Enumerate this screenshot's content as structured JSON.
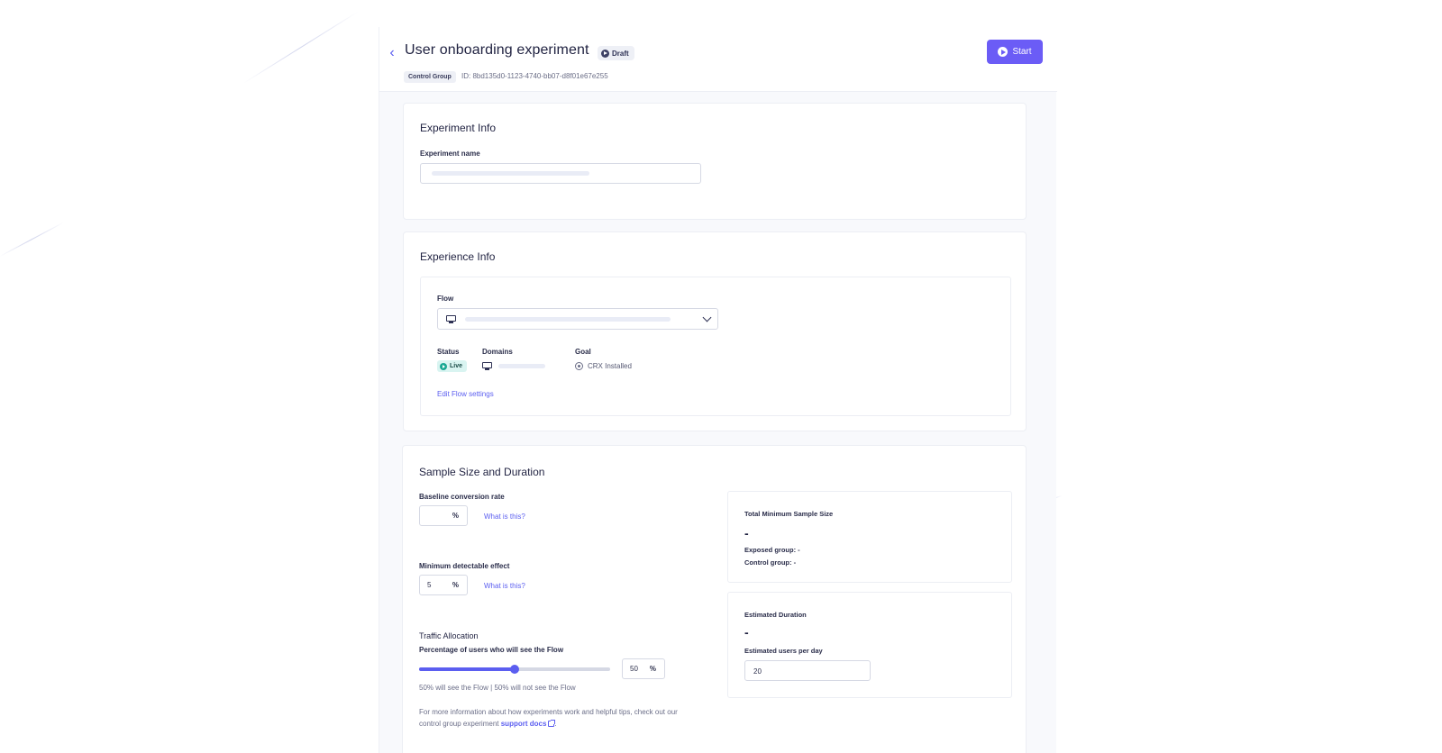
{
  "header": {
    "title": "User onboarding experiment",
    "status_badge": "Draft",
    "group_badge": "Control Group",
    "id_text": "ID: 8bd135d0-1123-4740-bb07-d8f01e67e255",
    "start_label": "Start"
  },
  "experiment_info": {
    "title": "Experiment Info",
    "name_label": "Experiment name"
  },
  "experience_info": {
    "title": "Experience Info",
    "flow_label": "Flow",
    "status_label": "Status",
    "status_value": "Live",
    "domains_label": "Domains",
    "goal_label": "Goal",
    "goal_value": "CRX Installed",
    "edit_link": "Edit Flow settings"
  },
  "sample": {
    "title": "Sample Size and Duration",
    "baseline_label": "Baseline conversion rate",
    "baseline_value": "",
    "pct_symbol": "%",
    "what_is_this": "What is this?",
    "mde_label": "Minimum detectable effect",
    "mde_value": "5",
    "traffic_title": "Traffic Allocation",
    "traffic_sub": "Percentage of users who will see the Flow",
    "traffic_value": "50",
    "traffic_percent": 50,
    "traffic_note": "50% will see the Flow | 50% will not see the Flow",
    "info_text_1": "For more information about how experiments work and helpful tips, check out our",
    "info_text_2": "control group experiment",
    "info_link": "support docs",
    "info_end": ".",
    "total_title": "Total Minimum Sample Size",
    "total_value": "-",
    "exposed_label": "Exposed group: -",
    "control_label": "Control group: -",
    "duration_title": "Estimated Duration",
    "duration_value": "-",
    "users_per_day_label": "Estimated users per day",
    "users_per_day_value": "20"
  },
  "colors": {
    "accent": "#5b5ef0",
    "start_button": "#6b5cf6",
    "live": "#1aa894"
  }
}
